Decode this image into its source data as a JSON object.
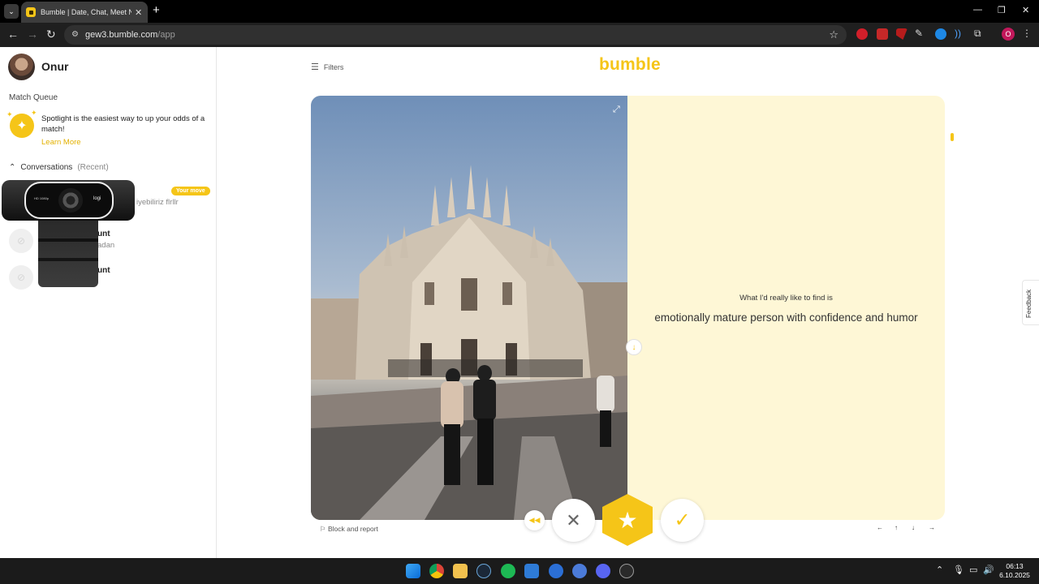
{
  "browser": {
    "tab_title": "Bumble | Date, Chat, Meet New",
    "tab_close": "✕",
    "new_tab": "+",
    "url_host": "gew3.bumble.com",
    "url_path": "/app",
    "profile_initial": "O",
    "window_controls": {
      "minimize": "—",
      "restore": "❐",
      "close": "✕"
    }
  },
  "sidebar": {
    "user_name": "Onur",
    "match_queue_title": "Match Queue",
    "spotlight_text": "Spotlight is the easiest way to up your odds of a match!",
    "learn_more": "Learn More",
    "conversations_title": "Conversations",
    "conversations_filter": "(Recent)",
    "conversations": [
      {
        "badge": "Your move",
        "message": "iyebiliriz flrllr"
      },
      {
        "name": "unt",
        "message": "adan"
      },
      {
        "name": "unt",
        "message": ""
      }
    ],
    "webcam_label_left": "HD 1080p",
    "webcam_brand": "logi"
  },
  "main": {
    "filters_label": "Filters",
    "logo_text": "bumble",
    "prompt_question": "What I'd really like to find is",
    "prompt_answer": "emotionally mature person with confidence and humor",
    "block_report": "Block and report",
    "keyboard_hints": [
      "←",
      "↑",
      "↓",
      "→"
    ],
    "feedback_label": "Feedback"
  },
  "taskbar": {
    "time": "06:13",
    "date": "6.10.2025"
  },
  "colors": {
    "brand": "#f5c518",
    "card_background": "#fef7d6"
  }
}
